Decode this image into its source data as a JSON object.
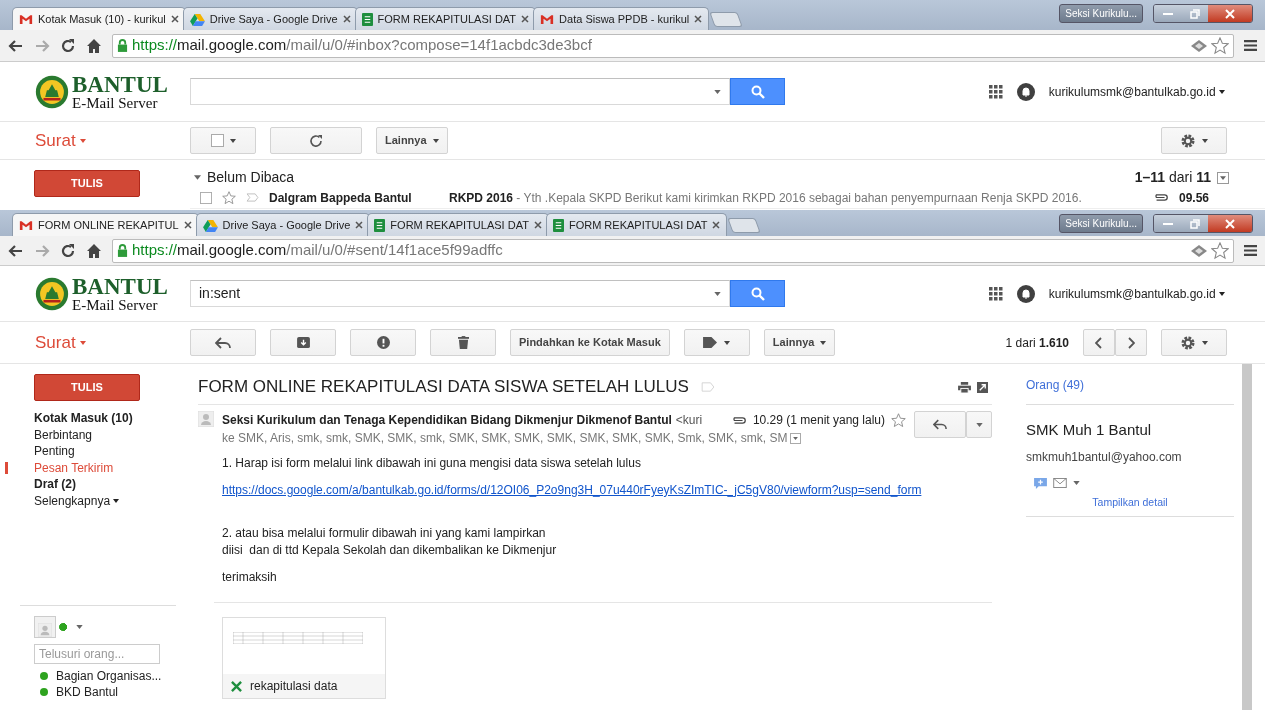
{
  "windows": [
    {
      "kind": "inbox",
      "tabs": [
        {
          "title": "Kotak Masuk (10) - kurikul",
          "kind": "mail",
          "selected": true
        },
        {
          "title": "Drive Saya - Google Drive",
          "kind": "drive",
          "selected": false
        },
        {
          "title": "FORM REKAPITULASI DAT",
          "kind": "spreadsheet",
          "selected": false
        },
        {
          "title": "Data Siswa PPDB - kurikul",
          "kind": "mail",
          "selected": false
        }
      ],
      "profile": "Seksi Kurikulu...",
      "url": {
        "scheme": "https://",
        "host": "mail.google.com",
        "path": "/mail/u/0/#inbox?compose=14f1acbdc3de3bcf"
      },
      "logo": {
        "title": "BANTUL",
        "subtitle": "E-Mail Server"
      },
      "account": "kurikulumsmk@bantulkab.go.id",
      "mail_menu": "Surat",
      "toolbar": {
        "more": "Lainnya"
      },
      "compose": "TULIS",
      "section": "Belum Dibaca",
      "range": "**1–11** dari **11**",
      "rows": [
        {
          "sender": "Dalgram Bappeda Bantul",
          "subject": "RKPD 2016",
          "snippet": " - Yth .Kepala SKPD Berikut kami kirimkan RKPD 2016 sebagai bahan penyempurnaan Renja SKPD 2016.",
          "time": "09.56",
          "checked": false,
          "starred": false,
          "attachment": true
        }
      ]
    },
    {
      "kind": "message",
      "tabs": [
        {
          "title": "FORM ONLINE REKAPITUL",
          "kind": "mail",
          "selected": true
        },
        {
          "title": "Drive Saya - Google Drive",
          "kind": "drive",
          "selected": false
        },
        {
          "title": "FORM REKAPITULASI DAT",
          "kind": "spreadsheet",
          "selected": false
        },
        {
          "title": "FORM REKAPITULASI DAT",
          "kind": "spreadsheet",
          "selected": false
        }
      ],
      "profile": "Seksi Kurikulu...",
      "url": {
        "scheme": "https://",
        "host": "mail.google.com",
        "path": "/mail/u/0/#sent/14f1ace5f99adffc"
      },
      "logo": {
        "title": "BANTUL",
        "subtitle": "E-Mail Server"
      },
      "search": {
        "value": "in:sent"
      },
      "account": "kurikulumsmk@bantulkab.go.id",
      "mail_menu": "Surat",
      "toolbar": {
        "move": "Pindahkan ke Kotak Masuk",
        "more": "Lainnya",
        "count": "1 dari **1.610**"
      },
      "compose": "TULIS",
      "folders": [
        {
          "label": "Kotak Masuk (10)",
          "bold": true,
          "selected": false
        },
        {
          "label": "Berbintang",
          "bold": false,
          "selected": false
        },
        {
          "label": "Penting",
          "bold": false,
          "selected": false
        },
        {
          "label": "Pesan Terkirim",
          "bold": false,
          "selected": true
        },
        {
          "label": "Draf (2)",
          "bold": true,
          "selected": false
        },
        {
          "label": "Selengkapnya",
          "bold": false,
          "selected": false
        }
      ],
      "chat": {
        "placeholder": "Telusuri orang...",
        "contacts": [
          {
            "name": "Bagian Organisas...",
            "color": "#2ea31f"
          },
          {
            "name": "BKD Bantul",
            "color": "#2ea31f"
          }
        ]
      },
      "message": {
        "subject": "FORM ONLINE REKAPITULASI DATA SISWA SETELAH LULUS",
        "sender": "Seksi Kurikulum dan Tenaga Kependidikan Bidang Dikmenjur Dikmenof Bantul",
        "sender_email": "<kuri",
        "time": "10.29 (1 menit yang lalu)",
        "starred": false,
        "recipients": "ke SMK, Aris, smk, smk, SMK, SMK, smk, SMK, SMK, SMK, SMK, SMK, SMK, SMK, Smk, SMK, smk, SM",
        "body": [
          {
            "kind": "text",
            "text": "1. Harap isi form melalui link dibawah ini guna mengisi data siswa setelah lulus"
          },
          {
            "kind": "link",
            "text": "https://docs.google.com/a/bantulkab.go.id/forms/d/12OI06_P2o9ng3H_07u440rFyeyKsZImTIC-_jC5gV80/viewform?usp=send_form"
          },
          {
            "kind": "text",
            "text": "2. atau bisa melalui formulir dibawah ini yang kami lampirkan"
          },
          {
            "kind": "text",
            "text": "diisi  dan di ttd Kepala Sekolah dan dikembalikan ke Dikmenjur"
          },
          {
            "kind": "text",
            "text": "terimaksih"
          }
        ],
        "attachment": {
          "name": "rekapitulasi data"
        }
      },
      "people": {
        "heading": "Orang (49)",
        "name": "SMK Muh 1 Bantul",
        "email": "smkmuh1bantul@yahoo.com",
        "details": "Tampilkan detail"
      }
    }
  ]
}
